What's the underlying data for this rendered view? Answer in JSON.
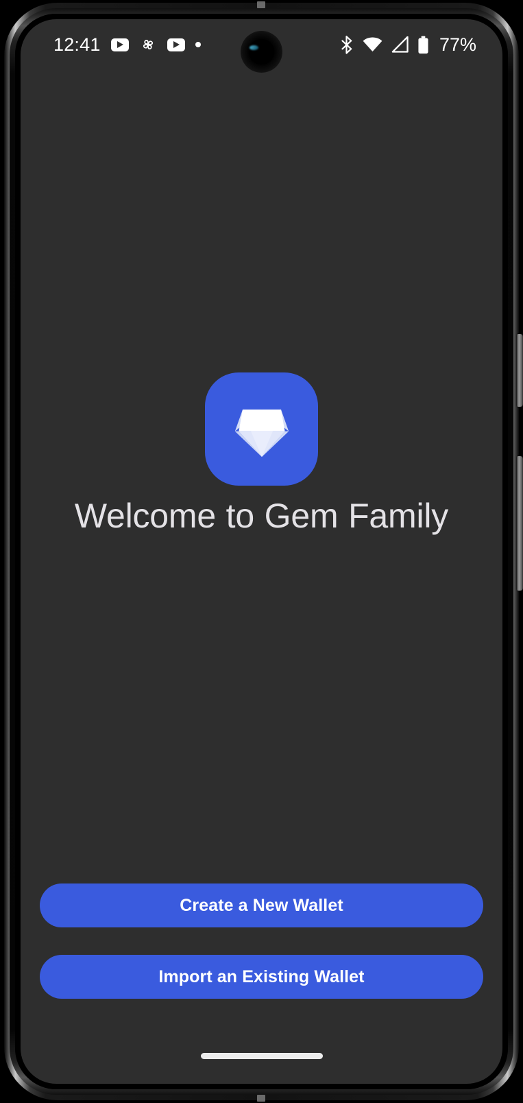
{
  "device": {
    "name": "android-phone",
    "screen_background": "#2E2E2E",
    "frame_color": "#0A0A0A",
    "side_buttons": [
      "power-button",
      "volume-rocker"
    ]
  },
  "status_bar": {
    "clock": "12:41",
    "left_icons": [
      {
        "name": "youtube-icon",
        "type": "youtube"
      },
      {
        "name": "google-photos-icon",
        "type": "pinwheel"
      },
      {
        "name": "youtube-icon",
        "type": "youtube"
      },
      {
        "name": "notification-dot-icon",
        "type": "dot"
      }
    ],
    "right_icons": [
      {
        "name": "bluetooth-icon",
        "type": "bluetooth"
      },
      {
        "name": "wifi-icon",
        "type": "wifi"
      },
      {
        "name": "cellular-signal-icon",
        "type": "signal"
      },
      {
        "name": "battery-icon",
        "type": "battery"
      }
    ],
    "battery_level": "77%",
    "text_color": "#FFFFFF"
  },
  "app": {
    "icon_name": "gem-app-icon",
    "icon_background": "#3A5BDE",
    "gem_colors": {
      "top_facet": "#FFFFFF",
      "left_facet": "#D3DCF7",
      "right_facet": "#DCE3F9",
      "bottom_left_facet": "#C8D3F4",
      "bottom_center_facet": "#E5EAFB",
      "bottom_right_facet": "#CFD9F6"
    }
  },
  "main": {
    "welcome_title": "Welcome to Gem Family",
    "title_color": "#E4E2E6"
  },
  "actions": {
    "accent_color": "#3A5BDE",
    "buttons": [
      {
        "name": "create-wallet-button",
        "label": "Create a New Wallet"
      },
      {
        "name": "import-wallet-button",
        "label": "Import an Existing Wallet"
      }
    ]
  },
  "navigation": {
    "home_indicator_color": "#EDEDED"
  }
}
